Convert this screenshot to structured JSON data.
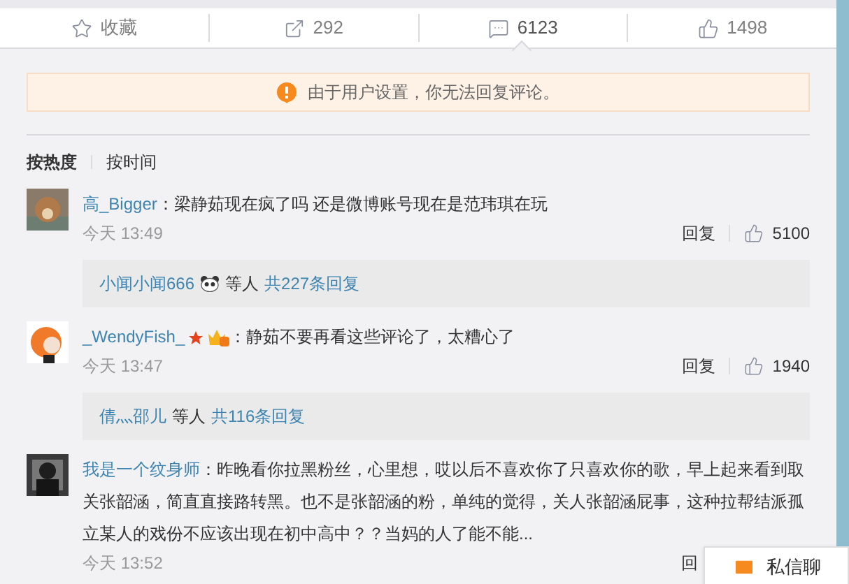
{
  "actions": [
    {
      "kind": "favorite",
      "label": "收藏",
      "selected": false
    },
    {
      "kind": "repost",
      "label": "292",
      "selected": false
    },
    {
      "kind": "comment",
      "label": "6123",
      "selected": true
    },
    {
      "kind": "like",
      "label": "1498",
      "selected": false
    }
  ],
  "notice": "由于用户设置，你无法回复评论。",
  "sort_tabs": [
    {
      "label": "按热度",
      "selected": true
    },
    {
      "label": "按时间",
      "selected": false
    }
  ],
  "comments": [
    {
      "user": "高_Bigger",
      "text": "：梁静茹现在疯了吗 还是微博账号现在是范玮琪在玩",
      "time": "今天 13:49",
      "reply_label": "回复",
      "likes": "5100",
      "replies": {
        "names": "小闻小闻666",
        "panda": true,
        "others": "等人",
        "count": "共227条回复"
      }
    },
    {
      "user": "_WendyFish_",
      "star_badge": true,
      "crown_badge": true,
      "text": "：静茹不要再看这些评论了，太糟心了",
      "time": "今天 13:47",
      "reply_label": "回复",
      "likes": "1940",
      "replies": {
        "names": "倩灬邵儿",
        "panda": false,
        "others": "等人",
        "count": "共116条回复"
      }
    },
    {
      "user": "我是一个纹身师",
      "text": "：昨晚看你拉黑粉丝，心里想，哎以后不喜欢你了只喜欢你的歌，早上起来看到取关张韶涵，简直直接路转黑。也不是张韶涵的粉，单纯的觉得，关人张韶涵屁事，这种拉帮结派孤立某人的戏份不应该出现在初中高中？？当妈的人了能不能...",
      "time": "今天 13:52",
      "reply_label": "回"
    }
  ],
  "chat_popup": {
    "label": "私信聊"
  }
}
